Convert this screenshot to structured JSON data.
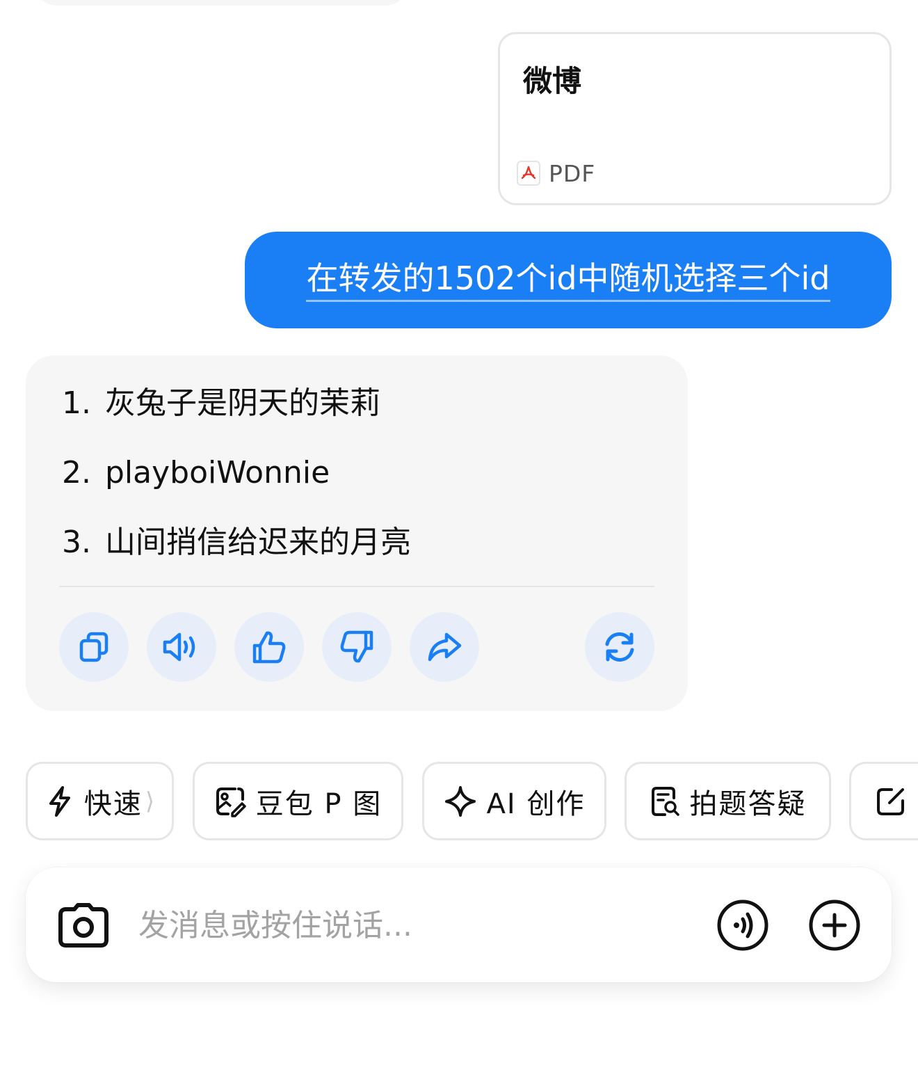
{
  "file_card": {
    "title": "微博",
    "type_label": "PDF"
  },
  "user_message": {
    "text": "在转发的1502个id中随机选择三个id"
  },
  "assistant_message": {
    "items": [
      {
        "number": "1.",
        "text": "灰兔子是阴天的茉莉"
      },
      {
        "number": "2.",
        "text": "playboiWonnie"
      },
      {
        "number": "3.",
        "text": "山间捎信给迟来的月亮"
      }
    ],
    "actions": [
      "copy-icon",
      "speaker-icon",
      "thumbs-up-icon",
      "thumbs-down-icon",
      "share-icon",
      "regenerate-icon"
    ],
    "accent_color": "#1a7ff4"
  },
  "quick_actions": [
    {
      "label": "快速",
      "icon": "lightning-icon",
      "has_caret": true,
      "caret": "⟩"
    },
    {
      "label": "豆包 P 图",
      "icon": "image-edit-icon"
    },
    {
      "label": "AI 创作",
      "icon": "sparkle-icon"
    },
    {
      "label": "拍题答疑",
      "icon": "document-search-icon"
    },
    {
      "label": "",
      "icon": "edit-note-icon"
    }
  ],
  "input_bar": {
    "placeholder": "发消息或按住说话..."
  },
  "colors": {
    "user_bubble": "#1a7ff4",
    "assistant_bubble": "#f6f6f6",
    "action_button_bg": "#e7eef9"
  }
}
